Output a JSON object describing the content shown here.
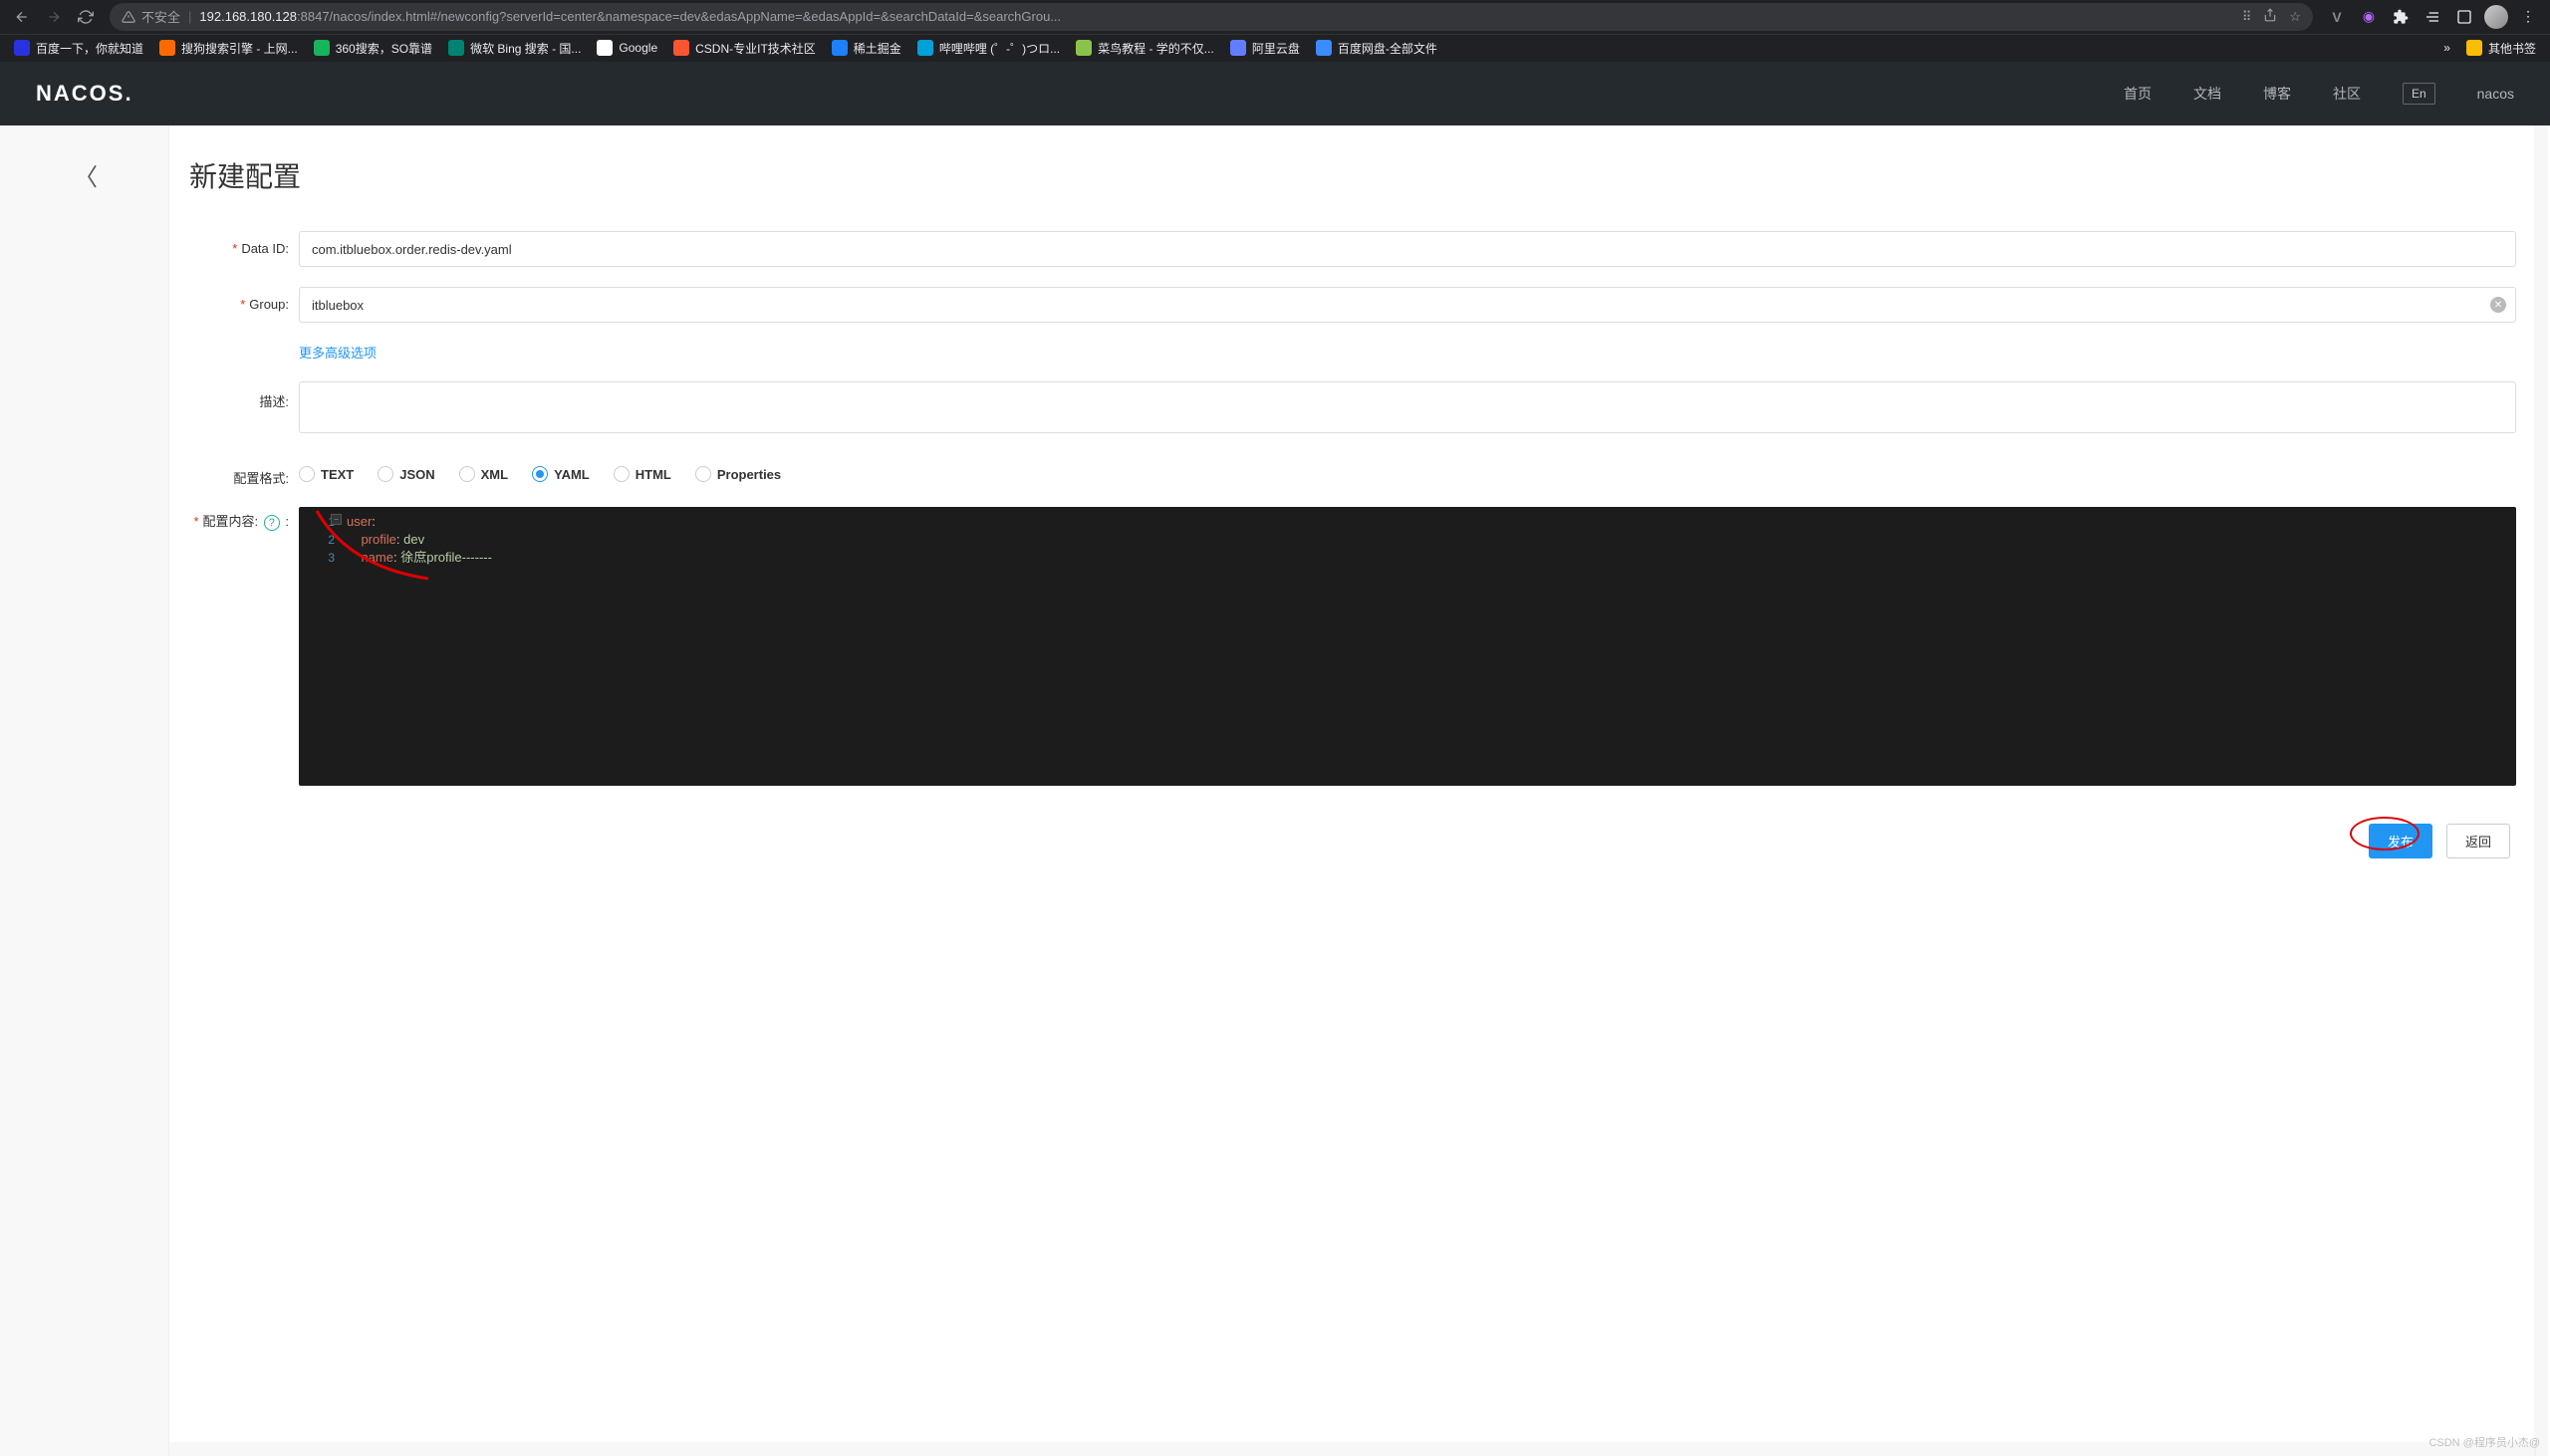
{
  "browser": {
    "insecure_label": "不安全",
    "url_host": "192.168.180.128",
    "url_port_path": ":8847/nacos/index.html#/newconfig?serverId=center&namespace=dev&edasAppName=&edasAppId=&searchDataId=&searchGrou...",
    "bookmarks": [
      {
        "label": "百度一下，你就知道",
        "color": "#2932e1"
      },
      {
        "label": "搜狗搜索引擎 - 上网...",
        "color": "#ff6a00"
      },
      {
        "label": "360搜索，SO靠谱",
        "color": "#17b35d"
      },
      {
        "label": "微软 Bing 搜索 - 国...",
        "color": "#008373"
      },
      {
        "label": "Google",
        "color": "#fff"
      },
      {
        "label": "CSDN-专业IT技术社区",
        "color": "#fc5531"
      },
      {
        "label": "稀土掘金",
        "color": "#1e80ff"
      },
      {
        "label": "哔哩哔哩 (゜-゜)つロ...",
        "color": "#00a1d6"
      },
      {
        "label": "菜鸟教程 - 学的不仅...",
        "color": "#8bc34a"
      },
      {
        "label": "阿里云盘",
        "color": "#637dff"
      },
      {
        "label": "百度网盘-全部文件",
        "color": "#3b8cff"
      }
    ],
    "more": "»",
    "other_bookmarks": "其他书签"
  },
  "header": {
    "logo": "NACOS.",
    "nav": [
      "首页",
      "文档",
      "博客",
      "社区"
    ],
    "lang": "En",
    "user": "nacos"
  },
  "page": {
    "title": "新建配置",
    "labels": {
      "data_id": "Data ID:",
      "group": "Group:",
      "desc": "描述:",
      "format": "配置格式:",
      "content": "配置内容:"
    },
    "advanced_link": "更多高级选项",
    "fields": {
      "data_id": "com.itbluebox.order.redis-dev.yaml",
      "group": "itbluebox",
      "desc": ""
    },
    "formats": [
      "TEXT",
      "JSON",
      "XML",
      "YAML",
      "HTML",
      "Properties"
    ],
    "selected_format": "YAML",
    "code": {
      "lines": [
        {
          "n": "1",
          "key": "user",
          "val": ""
        },
        {
          "n": "2",
          "key": "profile",
          "val": "dev",
          "indent": "    "
        },
        {
          "n": "3",
          "key": "name",
          "val": "徐庶profile-------",
          "indent": "    "
        }
      ]
    },
    "buttons": {
      "publish": "发布",
      "back": "返回"
    }
  },
  "watermark": "CSDN @程序员小杰@"
}
